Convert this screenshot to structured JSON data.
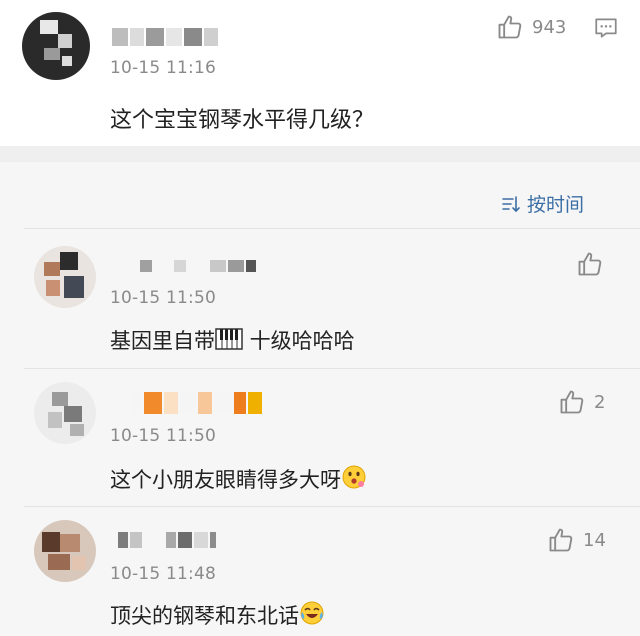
{
  "main_comment": {
    "likes": "943",
    "time": "10-15 11:16",
    "text": "这个宝宝钢琴水平得几级？"
  },
  "sort_label": "按时间",
  "replies": [
    {
      "time": "10-15 11:50",
      "text": "基因里自带",
      "text_suffix": " 十级哈哈哈",
      "likes": ""
    },
    {
      "time": "10-15 11:50",
      "text": "这个小朋友眼睛得多大呀",
      "likes": "2"
    },
    {
      "time": "10-15 11:48",
      "text": "顶尖的钢琴和东北话",
      "likes": "14"
    }
  ],
  "icons": {
    "like": "thumbs-up-icon",
    "reply": "comment-icon",
    "sort": "sort-icon",
    "piano": "piano-emoji-icon",
    "surprised": "surprised-emoji-icon",
    "laugh": "laugh-cry-emoji-icon"
  },
  "colors": {
    "accent": "#3b6ea5",
    "muted": "#8a8a8a"
  }
}
